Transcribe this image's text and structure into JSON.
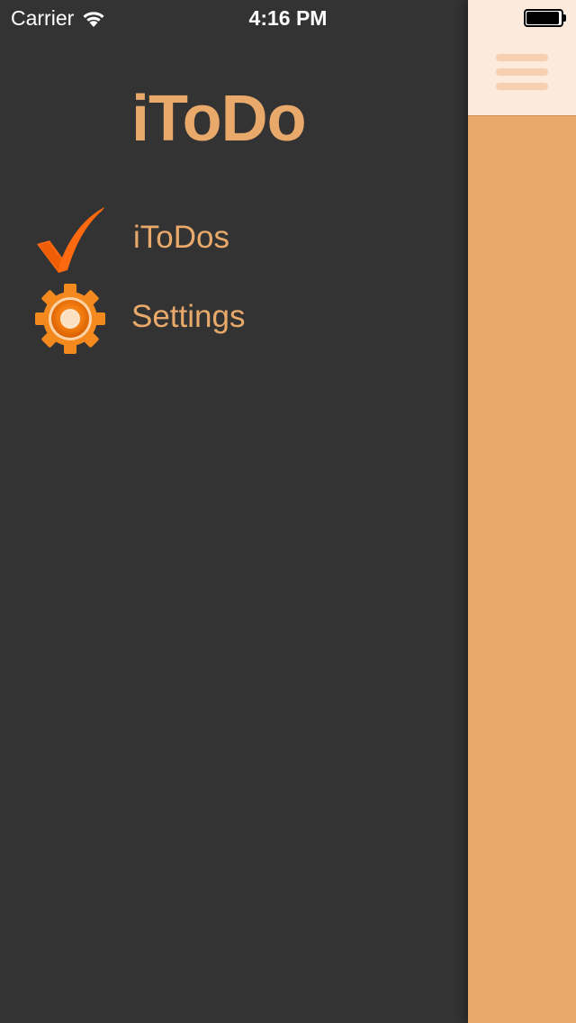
{
  "status_bar": {
    "carrier": "Carrier",
    "time": "4:16 PM",
    "wifi_icon": "wifi-icon",
    "battery_icon": "battery-full-icon"
  },
  "menu": {
    "title": "iToDo",
    "items": [
      {
        "label": "iToDos",
        "icon": "checkmark-icon"
      },
      {
        "label": "Settings",
        "icon": "gear-icon"
      }
    ]
  },
  "content": {
    "nav_icon": "hamburger-menu-icon"
  },
  "colors": {
    "menu_background": "#333333",
    "accent_text": "#e9a96b",
    "content_background": "#e8a96b",
    "nav_bar_background": "#fcebdc",
    "checkmark": "#ff6a10",
    "gear": "#f48a1e"
  }
}
